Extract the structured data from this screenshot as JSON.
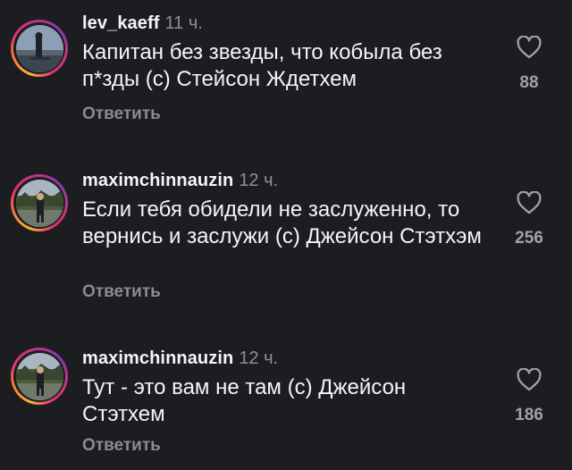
{
  "comments": [
    {
      "username": "lev_kaeff",
      "time": "11 ч.",
      "text": "Капитан без звезды, что кобыла без п*зды (с) Стейсон Ждетхем",
      "reply_label": "Ответить",
      "likes": "88",
      "like_icon": "heart-outline-icon"
    },
    {
      "username": "maximchinnauzin",
      "time": "12 ч.",
      "text": "Если тебя обидели не заслуженно, то вернись и заслужи (с) Джейсон Стэтхэм",
      "reply_label": "Ответить",
      "likes": "256",
      "like_icon": "heart-outline-icon"
    },
    {
      "username": "maximchinnauzin",
      "time": "12 ч.",
      "text": "Тут - это вам не там (с) Джейсон Стэтхем",
      "reply_label": "Ответить",
      "likes": "186",
      "like_icon": "heart-outline-icon"
    }
  ],
  "colors": {
    "background": "#1c1d21",
    "text": "#f5f5f5",
    "muted": "#8e8e93",
    "story_ring": [
      "#f9b233",
      "#e1306c",
      "#833ab4"
    ]
  }
}
